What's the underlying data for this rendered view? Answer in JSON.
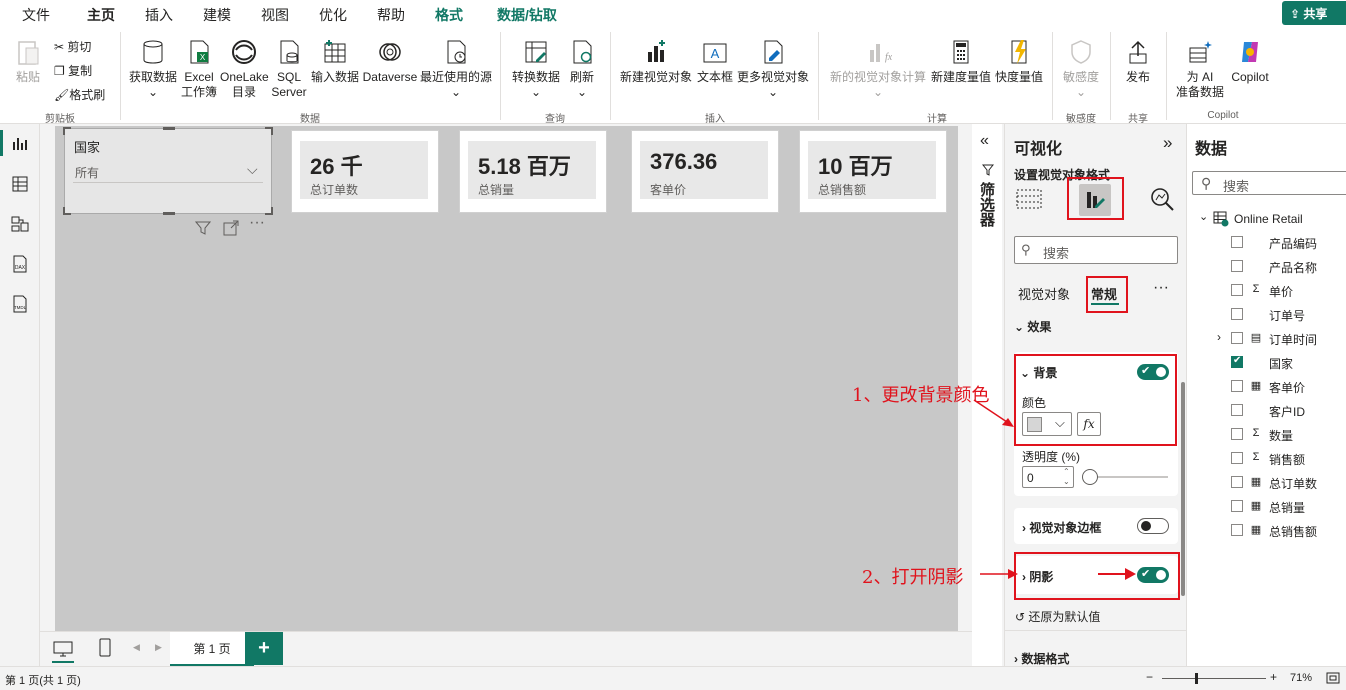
{
  "menu": {
    "tabs": [
      "文件",
      "主页",
      "插入",
      "建模",
      "视图",
      "优化",
      "帮助",
      "格式",
      "数据/钻取"
    ],
    "share_label": "共享"
  },
  "ribbon": {
    "clipboard": {
      "paste": "粘贴",
      "cut": "剪切",
      "copy": "复制",
      "format_painter": "格式刷",
      "group": "剪贴板"
    },
    "data": {
      "get_data": "获取数据",
      "excel": "Excel\n工作簿",
      "onelake": "OneLake\n目录",
      "sql": "SQL\nServer",
      "enter_data": "输入数据",
      "dataverse": "Dataverse",
      "recent": "最近使用的源",
      "group": "数据"
    },
    "query": {
      "transform": "转换数据",
      "refresh": "刷新",
      "group": "查询"
    },
    "insert": {
      "new_visual": "新建视觉对象",
      "textbox": "文本框",
      "more_visuals": "更多视觉对象",
      "group": "插入"
    },
    "calc": {
      "new_visual_calc": "新的视觉对象计算",
      "new_measure": "新建度量值",
      "quick_measure": "快度量值",
      "group": "计算"
    },
    "sensitivity": {
      "label": "敏感度",
      "group": "敏感度"
    },
    "share": {
      "publish": "发布",
      "group": "共享"
    },
    "copilot": {
      "prep": "为 AI\n准备数据",
      "copilot": "Copilot",
      "group": "Copilot"
    }
  },
  "slicer": {
    "title": "国家",
    "value": "所有"
  },
  "cards": [
    {
      "value": "26 千",
      "label": "总订单数"
    },
    {
      "value": "5.18 百万",
      "label": "总销量"
    },
    {
      "value": "376.36",
      "label": "客单价"
    },
    {
      "value": "10 百万",
      "label": "总销售额"
    }
  ],
  "filters_label": "筛选器",
  "viz": {
    "title": "可视化",
    "subtitle": "设置视觉对象格式",
    "search_placeholder": "搜索",
    "tab_visual": "视觉对象",
    "tab_general": "常规",
    "effects": "效果",
    "background": "背景",
    "color": "颜色",
    "transparency": "透明度 (%)",
    "transparency_value": "0",
    "border": "视觉对象边框",
    "shadow": "阴影",
    "reset": "还原为默认值",
    "data_format": "数据格式",
    "fx": "fx",
    "background_on": true,
    "border_on": false,
    "shadow_on": true
  },
  "data_pane": {
    "title": "数据",
    "search_placeholder": "搜索",
    "table": "Online Retail",
    "fields": [
      {
        "name": "产品编码",
        "icon": "",
        "checked": false
      },
      {
        "name": "产品名称",
        "icon": "",
        "checked": false
      },
      {
        "name": "单价",
        "icon": "Σ",
        "checked": false
      },
      {
        "name": "订单号",
        "icon": "",
        "checked": false
      },
      {
        "name": "订单时间",
        "icon": "calendar",
        "checked": false
      },
      {
        "name": "国家",
        "icon": "",
        "checked": true
      },
      {
        "name": "客单价",
        "icon": "calc",
        "checked": false
      },
      {
        "name": "客户ID",
        "icon": "",
        "checked": false
      },
      {
        "name": "数量",
        "icon": "Σ",
        "checked": false
      },
      {
        "name": "销售额",
        "icon": "Σ",
        "checked": false
      },
      {
        "name": "总订单数",
        "icon": "calc",
        "checked": false
      },
      {
        "name": "总销量",
        "icon": "calc",
        "checked": false
      },
      {
        "name": "总销售额",
        "icon": "calc",
        "checked": false
      }
    ]
  },
  "page_tab": "第 1 页",
  "status": {
    "page_info": "第 1 页(共 1 页)",
    "zoom": "71%"
  },
  "annotations": {
    "step1": "1、更改背景颜色",
    "step2": "2、打开阴影"
  },
  "colors": {
    "accent": "#117865",
    "annotation": "#e0131d"
  }
}
